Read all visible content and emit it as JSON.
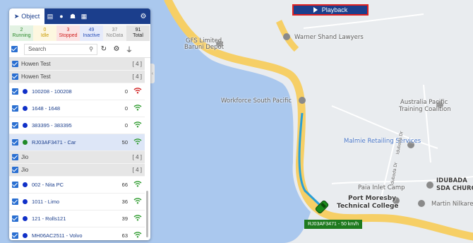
{
  "playback": {
    "label": "Playback"
  },
  "tabs": {
    "active_label": "Object"
  },
  "stats": [
    {
      "value": "2",
      "label": "Running",
      "color": "#2e8b2e",
      "bg": "#e3f2e3"
    },
    {
      "value": "0",
      "label": "Idle",
      "color": "#c89a00",
      "bg": "#fdf7e0"
    },
    {
      "value": "3",
      "label": "Stopped",
      "color": "#d02020",
      "bg": "#fbe3e3"
    },
    {
      "value": "49",
      "label": "Inactive",
      "color": "#2a4fb8",
      "bg": "#e5eafa"
    },
    {
      "value": "37",
      "label": "NoData",
      "color": "#8a8a8a",
      "bg": "#f2f2f2"
    },
    {
      "value": "91",
      "label": "Total",
      "color": "#222222",
      "bg": "#e3e3e3"
    }
  ],
  "search": {
    "placeholder": "Search"
  },
  "list": [
    {
      "kind": "group",
      "label": "Howen Test",
      "count": "[ 4 ]"
    },
    {
      "kind": "group",
      "label": "Howen Test",
      "count": "[ 4 ]"
    },
    {
      "kind": "row",
      "name": "100208 - 100208",
      "speed": "0",
      "dot": "#1030c8",
      "signal": "red"
    },
    {
      "kind": "row",
      "name": "1648 - 1648",
      "speed": "0",
      "dot": "#1030c8",
      "signal": "green"
    },
    {
      "kind": "row",
      "name": "383395 - 383395",
      "speed": "0",
      "dot": "#1030c8",
      "signal": "green"
    },
    {
      "kind": "row",
      "name": "RJ03AF3471 - Car",
      "speed": "50",
      "dot": "#1f8a2a",
      "signal": "green",
      "selected": true
    },
    {
      "kind": "group",
      "label": "Jio",
      "count": "[ 4 ]"
    },
    {
      "kind": "group",
      "label": "Jio",
      "count": "[ 4 ]"
    },
    {
      "kind": "row",
      "name": "002 - Nita PC",
      "speed": "66",
      "dot": "#1030c8",
      "signal": "green"
    },
    {
      "kind": "row",
      "name": "1011 - Limo",
      "speed": "36",
      "dot": "#1030c8",
      "signal": "green"
    },
    {
      "kind": "row",
      "name": "121 - Rolls121",
      "speed": "39",
      "dot": "#1030c8",
      "signal": "green"
    },
    {
      "kind": "row",
      "name": "MH06AC2511 - Volvo",
      "speed": "63",
      "dot": "#1030c8",
      "signal": "green"
    }
  ],
  "map": {
    "places": {
      "gfs": "GFS Limited,",
      "gfs2": "Baruni Depot",
      "warner": "Warner Shand Lawyers",
      "workforce": "Workforce South Pacific",
      "australia": "Australia Pacific",
      "australia2": "Training Coalition",
      "malmie": "Malmie Retailing Services",
      "idubada_dr": "Idubada Dr",
      "idubada_dr2": "Idubada Dr",
      "paia": "Paia Inlet Camp",
      "idubada_sda": "IDUBADA",
      "idubada_sda2": "SDA CHURC",
      "port": "Port Moresby",
      "port2": "Technical College",
      "martin": "Martin Nilkare"
    },
    "vehicle_label": "RJ03AF3471 - 50 km/h"
  }
}
